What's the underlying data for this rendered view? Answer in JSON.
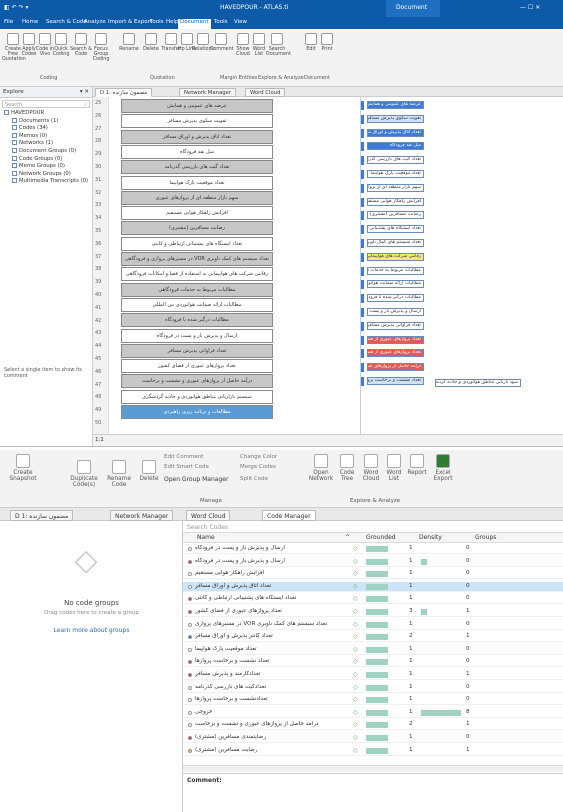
{
  "s1": {
    "title_doc": "HAVEDPOUR - ATLAS.ti",
    "title_ctx": "Document",
    "menu": [
      "File",
      "Home",
      "Search & Code",
      "Analyze",
      "Import & Export",
      "Tools",
      "Help",
      "Document",
      "Tools",
      "View"
    ],
    "ribbon_buttons": [
      "Create Free Quotation",
      "Apply Codes",
      "Code in Vivo",
      "Quick Coding",
      "Search & Code",
      "Focus Group Coding",
      "Rename",
      "Delete",
      "Transfer",
      "Hp Link",
      "Relations",
      "Comment",
      "Show Cloud",
      "Word List",
      "Search Document",
      "Edit",
      "Print"
    ],
    "ribbon_groups": [
      "Coding",
      "Quotation",
      "Margin Entities",
      "Explore & Analyze",
      "Document"
    ],
    "explorer_title": "Explore",
    "search_placeholder": "Search",
    "tree": [
      "HAVEDPOUR",
      "Documents (1)",
      "Codes (34)",
      "Memos (0)",
      "Networks (1)",
      "Document Groups (0)",
      "Code Groups (0)",
      "Memo Groups (0)",
      "Network Groups (0)",
      "Multimedia Transcripts (0)"
    ],
    "hint": "Select a single item to show its comment",
    "tabs": [
      "D 1: مضمون سازنده",
      "Network Manager",
      "Word Cloud"
    ],
    "line_numbers": [
      "25",
      "26",
      "27",
      "28",
      "29",
      "30",
      "31",
      "32",
      "33",
      "34",
      "35",
      "36",
      "37",
      "38",
      "39",
      "40",
      "41",
      "42",
      "43",
      "44",
      "45",
      "46",
      "47",
      "48",
      "49",
      "50"
    ],
    "cells": [
      "عرضه های عمومی و همایش",
      "تقویت سکوی پذیرش مسافر",
      "تعداد اتاق پذیرش و اوراق مسافر",
      "میل نقد فرودگاه",
      "تعداد گیت های بازرسی گذرنامه",
      "تعداد موقعیت پارک هواپیما",
      "سهم بازار منطقه ای از پروازهای عبوری",
      "افزایش راهکار هوایی مستقیم",
      "رضایت مسافرین (مشتری)",
      "تعداد ایستگاه های پشتیبانی ارتباطی و کانتی",
      "تعداد سیستم های کمک ناوبری VOR در مسیرهای پروازی و فرودگاهی",
      "رقابتی شرکت های هواپیمایی به استفاده از فضا و امکانات فرودگاهی",
      "مطالبات مربوط به خدمات فرودگاهی",
      "مطالبات ارائه ضمانت هوانوردی بین المللی",
      "مطالبات درگیر شده با فرودگاه",
      "ارسال و پذیرش بار و پست در فرودگاه",
      "تعداد فراوانی پذیرش مسافر",
      "تعداد پروازهای عبوری از فضای کشور",
      "درآمد حاصل از پروازهای عبوری و نشست و برخاست",
      "سیستم بازاریابی مناطق هوانوردی و جاذبه گردشگری",
      "مطالعات و برنامه ریزی راهبردی"
    ],
    "margin_tags": [
      "عرضه های عمومی و همایش",
      "تقویت سکوی پذیرش مسافر",
      "تعداد اتاق پذیرش و اوراق مسافر",
      "میل نقد فرودگاه",
      "تعداد گیت های بازرسی گذرنامه",
      "تعداد موقعیت پارک هواپیما",
      "سهم بازار منطقه ای از پروازهای عبوری",
      "افزایش راهکار هوایی مستقیم",
      "رضایت مسافرین (مشتری)",
      "تعداد ایستگاه های پشتیبانی ارتباطی",
      "تعداد سیستم های کمک ناوبری",
      "رقابتی شرکت های هواپیمایی",
      "مطالبات مربوط به خدمات فرودگاهی",
      "مطالبات ارائه ضمانت هوانوردی",
      "مطالبات درگیر شده با فرودگاه",
      "ارسال و پذیرش بار و پست در فرودگاه",
      "تعداد فراوانی پذیرش مسافر",
      "تعداد پروازهای عبوری از فضای کشور",
      "تعداد پروازهای عبوری از فضای کشور",
      "درآمد حاصل از پروازهای عبوری",
      "تعداد نشست و برخاست پروازها"
    ],
    "margin_extra": "سود بازیابی مناطق هوانوردی و جاذبه گردشگری",
    "status": "1:1"
  },
  "s2": {
    "ribbon": [
      "Create Snapshot",
      "Duplicate Code(s)",
      "Rename Code",
      "Delete",
      "Edit Comment",
      "Edit Smart Code",
      "Open Group Manager",
      "Change Color",
      "Merge Codes",
      "Split Code",
      "Open Network",
      "Code Tree",
      "Word Cloud",
      "Word List",
      "Report",
      "Excel Export"
    ],
    "group_manage": "Manage",
    "group_explore": "Explore & Analyze",
    "tabs": [
      "D 1: مضمون سازنده",
      "Network Manager",
      "Word Cloud",
      "Code Manager"
    ],
    "no_groups": "No code groups",
    "drag_hint": "Drag codes here to create a group",
    "learn_more": "Learn more about groups",
    "search_placeholder": "Search Codes",
    "columns": [
      "Name",
      "Grounded",
      "Density",
      "Groups"
    ],
    "rows": [
      {
        "name": "ارسال و پذیرش بار و پست در فرودگاه",
        "grounded": "1",
        "density": "",
        "groups": "0"
      },
      {
        "name": "ارسال و پذیرش بار و پست در فرودگاه",
        "grounded": "1",
        "density": "",
        "groups": "0"
      },
      {
        "name": "افزایش راهکار هوایی مستقیم",
        "grounded": "1",
        "density": "",
        "groups": "0"
      },
      {
        "name": "تعداد اتاق پذیرش و اوراق مسافر",
        "grounded": "1",
        "density": "",
        "groups": "0"
      },
      {
        "name": "تعداد ایستگاه های پشتیبانی ارتباطی و کانتی",
        "grounded": "1",
        "density": "",
        "groups": "0"
      },
      {
        "name": "تعداد پروازهای عبوری از فضای کشور",
        "grounded": "3",
        "density": "",
        "groups": "1"
      },
      {
        "name": "تعداد سیستم های کمک ناوبری VOR در مسیرهای پروازی",
        "grounded": "1",
        "density": "",
        "groups": "0"
      },
      {
        "name": "تعداد کانتر پذیرش و اوراق مسافر",
        "grounded": "2",
        "density": "",
        "groups": "1"
      },
      {
        "name": "تعداد موقعیت پارک هواپیما",
        "grounded": "1",
        "density": "",
        "groups": "0"
      },
      {
        "name": "تعداد نشست و برخاست پروازها",
        "grounded": "1",
        "density": "",
        "groups": "0"
      },
      {
        "name": "تعدادکارمند و پذیرش مسافر",
        "grounded": "1",
        "density": "",
        "groups": "1"
      },
      {
        "name": "تعدادگیت های بازرسی گذرنامه",
        "grounded": "1",
        "density": "",
        "groups": "0"
      },
      {
        "name": "تعدادنشست و برخاست پروازها",
        "grounded": "1",
        "density": "",
        "groups": "0"
      },
      {
        "name": "خروجی",
        "grounded": "1",
        "density": "",
        "groups": "8"
      },
      {
        "name": "درآمد حاصل از پروازهای عبوری و نشست و برخاست",
        "grounded": "2",
        "density": "",
        "groups": "1"
      },
      {
        "name": "رضایتمندی مسافرین (مشتری)",
        "grounded": "1",
        "density": "",
        "groups": "0"
      },
      {
        "name": "رضایت مسافرین (مشتری)",
        "grounded": "1",
        "density": "",
        "groups": "1"
      }
    ],
    "comment_label": "Comment:"
  }
}
